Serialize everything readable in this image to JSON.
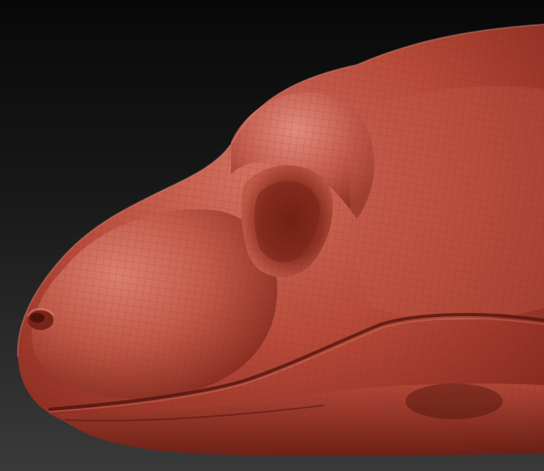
{
  "viewport": {
    "background_top": "#080808",
    "background_bottom": "#3a3a3a",
    "material": {
      "base": "#b84a3a",
      "highlight": "#d97a6a",
      "shadow": "#5a1810",
      "wire": "#7a2a20"
    }
  }
}
